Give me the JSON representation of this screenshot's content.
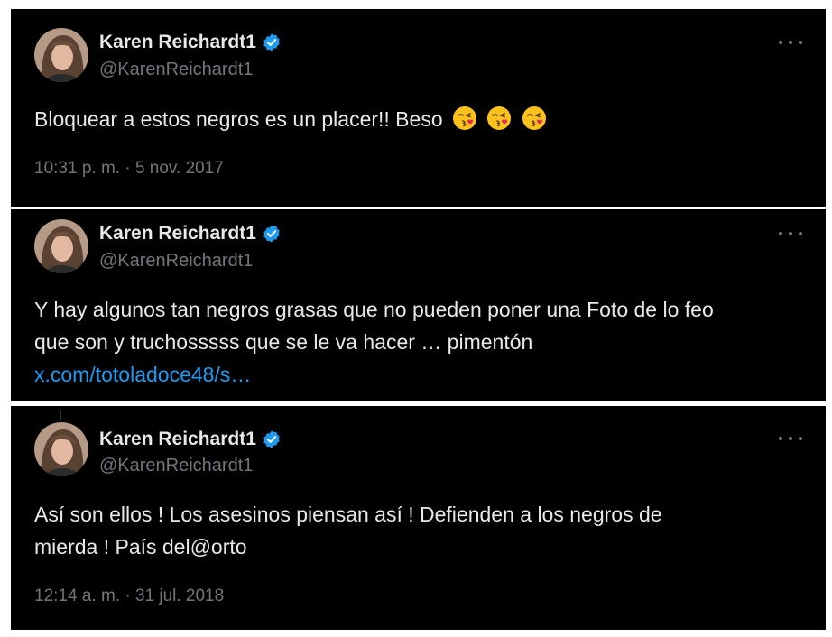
{
  "colors": {
    "background": "#000000",
    "text": "#e7e9ea",
    "secondary": "#71767b",
    "link": "#1d9bf0",
    "verified": "#1d9bf0"
  },
  "tweets": [
    {
      "author": {
        "display_name": "Karen Reichardt1",
        "handle": "@KarenReichardt1",
        "verified": true
      },
      "lines": [
        "Bloquear a estos negros es un placer!! Beso"
      ],
      "emojis": [
        "kissing-face-with-heart",
        "kissing-face-with-heart",
        "kissing-face-with-heart"
      ],
      "timestamp": "10:31 p. m. · 5 nov. 2017"
    },
    {
      "author": {
        "display_name": "Karen Reichardt1",
        "handle": "@KarenReichardt1",
        "verified": true
      },
      "lines": [
        "Y hay algunos tan negros grasas que no pueden poner una Foto de lo feo",
        "que son y truchosssss que se le va hacer … pimentón"
      ],
      "link": "x.com/totoladoce48/s…"
    },
    {
      "author": {
        "display_name": "Karen Reichardt1",
        "handle": "@KarenReichardt1",
        "verified": true
      },
      "lines": [
        "Así son ellos ! Los asesinos piensan así ! Defienden a los negros de",
        "mierda ! País del@orto"
      ],
      "timestamp": "12:14 a. m. · 31 jul. 2018"
    }
  ]
}
